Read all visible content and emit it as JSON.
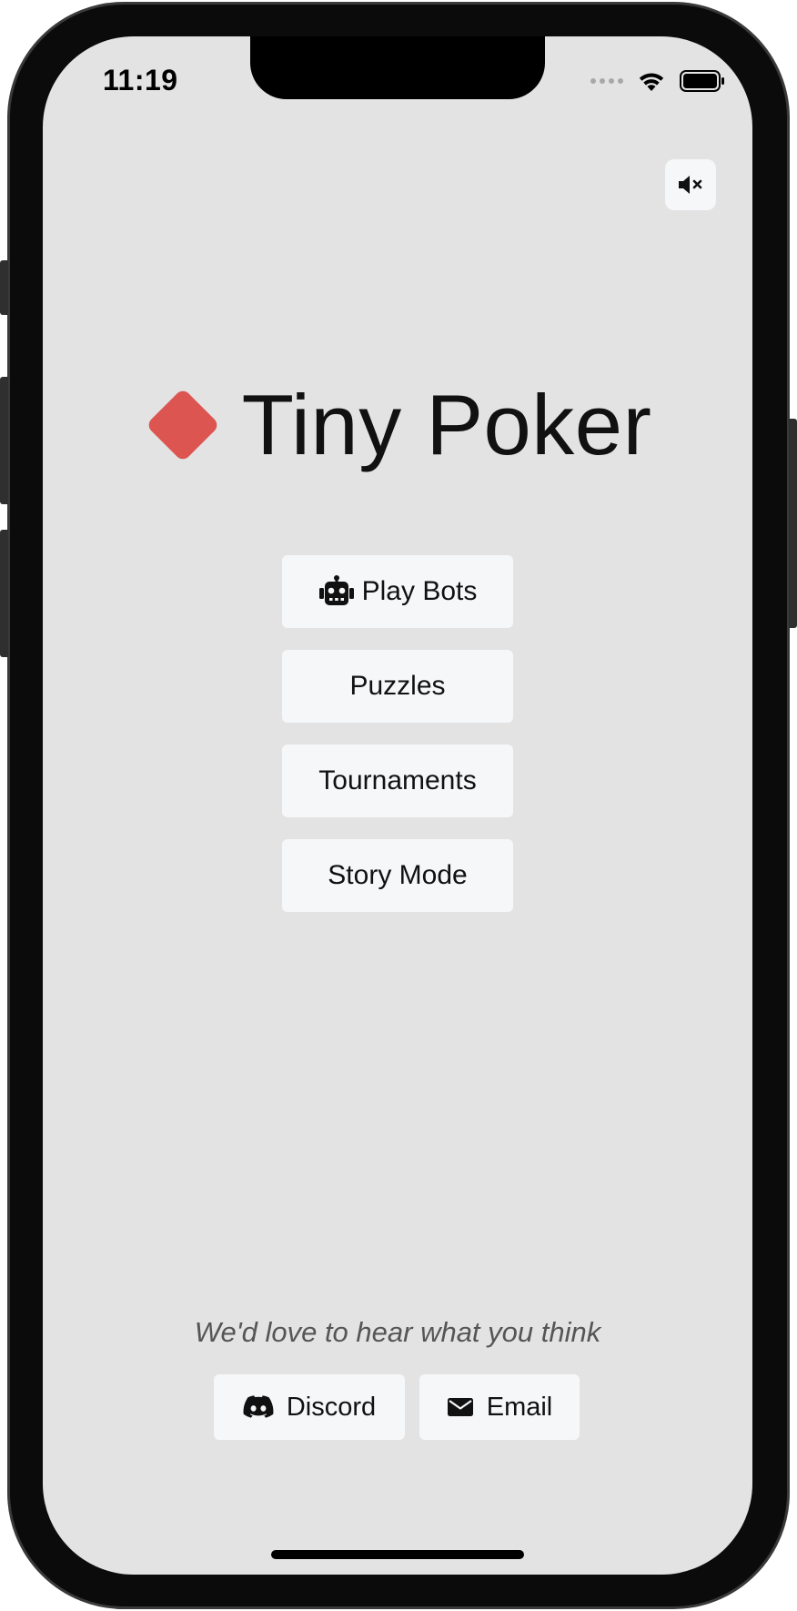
{
  "status_bar": {
    "time": "11:19",
    "icons": [
      "signal-icon",
      "wifi-icon",
      "battery-icon"
    ]
  },
  "controls": {
    "mute_icon": "speaker-muted-icon"
  },
  "header": {
    "logo_icon": "red-diamond-icon",
    "logo_color": "#dc5550",
    "title": "Tiny Poker"
  },
  "menu": {
    "play_bots": {
      "label": "Play Bots",
      "icon": "robot-icon"
    },
    "puzzles": {
      "label": "Puzzles"
    },
    "tournaments": {
      "label": "Tournaments"
    },
    "story_mode": {
      "label": "Story Mode"
    }
  },
  "feedback": {
    "prompt": "We'd love to hear what you think",
    "discord": {
      "label": "Discord",
      "icon": "discord-icon"
    },
    "email": {
      "label": "Email",
      "icon": "envelope-icon"
    }
  },
  "colors": {
    "background": "#e3e3e4",
    "button": "#f6f7f9",
    "text": "#111111"
  }
}
